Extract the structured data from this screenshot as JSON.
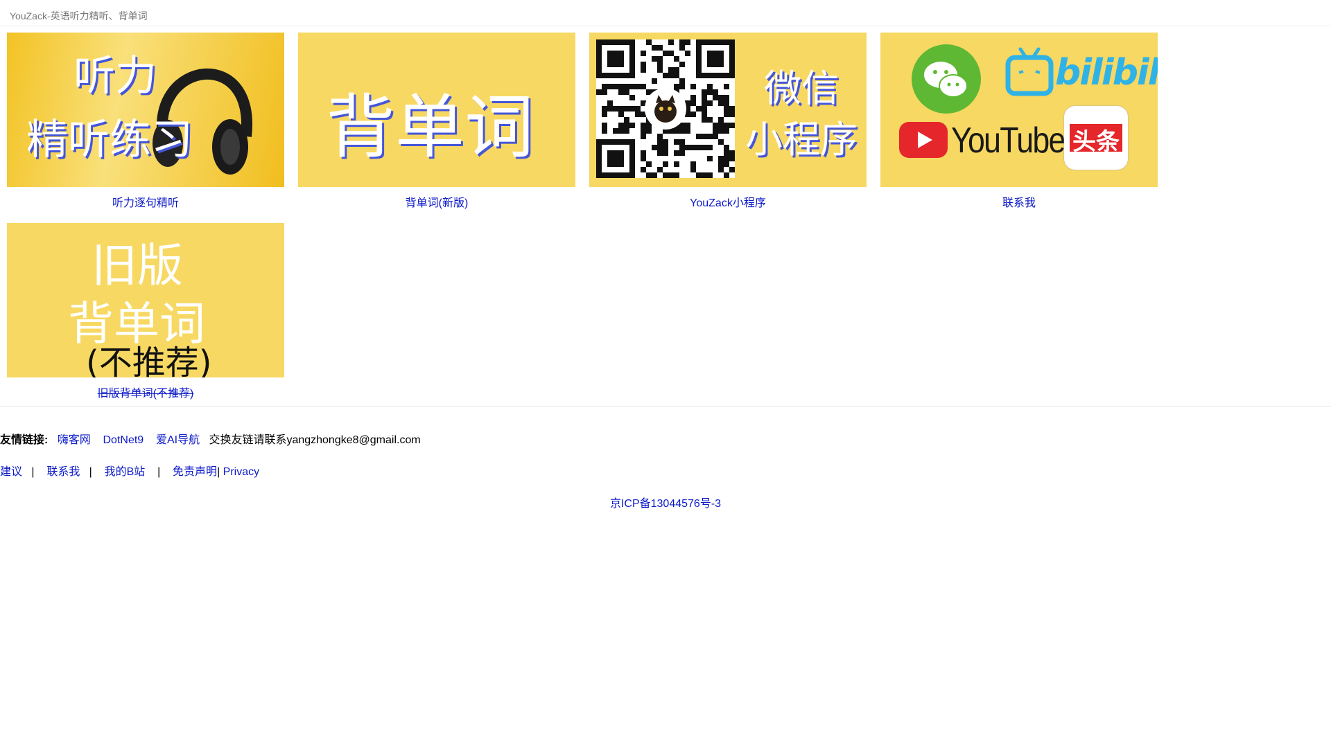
{
  "page": {
    "title": "YouZack-英语听力精听、背单词"
  },
  "tiles": [
    {
      "img_lines": [
        "听力",
        "精听练习"
      ],
      "caption": "听力逐句精听"
    },
    {
      "img_text": "背单词",
      "caption": "背单词(新版)"
    },
    {
      "img_lines": [
        "微信",
        "小程序"
      ],
      "caption": "YouZack小程序"
    },
    {
      "logos": [
        "bilibili",
        "YouTube",
        "头条"
      ],
      "caption": "联系我"
    },
    {
      "img_lines": [
        "旧版",
        "背单词",
        "(不推荐)"
      ],
      "caption": "旧版背单词(不推荐)"
    }
  ],
  "friends": {
    "label": "友情链接:",
    "links": [
      "嗨客网",
      "DotNet9",
      "爱AI导航"
    ],
    "contact": "交换友链请联系yangzhongke8@gmail.com"
  },
  "footer_links": [
    "建议",
    "联系我",
    "我的B站",
    "免责声明",
    "Privacy"
  ],
  "icp": "京ICP备13044576号-3",
  "colors": {
    "tile_bg": "#f7d862",
    "link": "#0a18c8",
    "text_shadow": "#4556d8"
  }
}
